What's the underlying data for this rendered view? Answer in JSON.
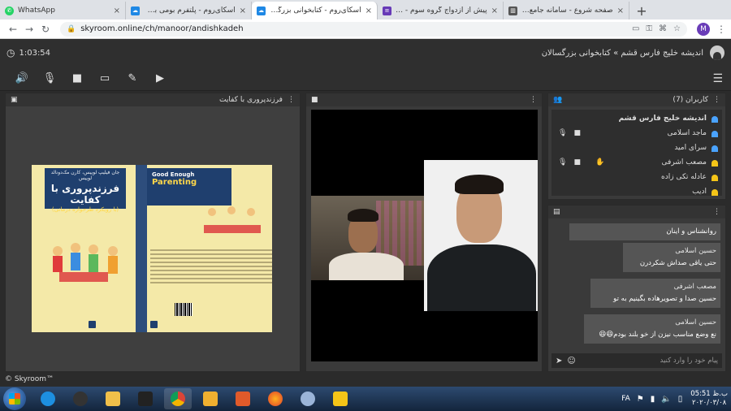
{
  "browser": {
    "tabs": [
      {
        "title": "WhatsApp",
        "icon_color": "#25d366",
        "icon": "whatsapp-icon"
      },
      {
        "title": "اسکای‌روم - پلتفرم بومی برگزاری وبینار",
        "icon_color": "#1e88e5",
        "icon": "skyroom-icon"
      },
      {
        "title": "اسکای‌روم - کتابخوانی بزرگسالان",
        "icon_color": "#1e88e5",
        "icon": "skyroom-icon",
        "active": true
      },
      {
        "title": "پیش از ازدواج گروه سوم - Google Forms",
        "icon_color": "#673ab7",
        "icon": "forms-icon"
      },
      {
        "title": "صفحه شروع - سامانه جامع ارتباط فرهنگیان",
        "icon_color": "#555555",
        "icon": "bank-icon"
      }
    ],
    "url": "skyroom.online/ch/manoor/andishkadeh",
    "profile_initial": "M"
  },
  "header": {
    "timer": "1:03:54",
    "room_title": "اندیشه خلیج فارس قشم » کتابخوانی بزرگسالان"
  },
  "document": {
    "title": "فرزندپروری با کفایت",
    "book": {
      "authors": "جان فیلیپ لوییس، کارن مک‌دونالد لوییس",
      "title_fa": "فرزندپروری با کفایت",
      "subtitle_fa": "(با رویکرد طرحواره درمانی)",
      "title_en_1": "Good Enough",
      "title_en_2": "Parenting",
      "spine_text": "فرزندپروری با کفایت"
    }
  },
  "users": {
    "title": "کاربران (7)",
    "list": [
      {
        "name": "اندیشه خلیج فارس قشم",
        "role": "admin",
        "color": "#4aa3ff",
        "bold": true,
        "mic": false,
        "cam": false
      },
      {
        "name": "ماجد اسلامی",
        "role": "user",
        "color": "#4aa3ff",
        "mic": true,
        "cam": true
      },
      {
        "name": "سرای امید",
        "role": "user",
        "color": "#4aa3ff",
        "mic": false,
        "cam": false
      },
      {
        "name": "مصعب اشرفی",
        "role": "user",
        "color": "#f5c518",
        "mic": true,
        "cam": true,
        "hand": true
      },
      {
        "name": "عادله تکی زاده",
        "role": "user",
        "color": "#f5c518",
        "mic": false,
        "cam": false
      },
      {
        "name": "ادیب",
        "role": "user",
        "color": "#f5c518",
        "mic": false,
        "cam": false
      }
    ]
  },
  "chat": {
    "messages": [
      {
        "sender": "",
        "text": "روانشناس و اینان"
      },
      {
        "sender": "حسین اسلامی",
        "text": "حتی یاقی صداش شکردرن"
      },
      {
        "sender": "مصعب اشرفی",
        "text": "حسین صدا و تصویرهاده بگینیم به تو"
      },
      {
        "sender": "حسین اسلامی",
        "text": "نع وضع مناسب نیزن از خو بلند بودم😆😆"
      }
    ],
    "placeholder": "پیام خود را وارد کنید"
  },
  "footer": {
    "brand": "© Skyroom™"
  },
  "taskbar": {
    "lang": "FA",
    "time": "05:51 ب.ظ",
    "date": "۲۰۲۰/۰۳/۰۸"
  }
}
